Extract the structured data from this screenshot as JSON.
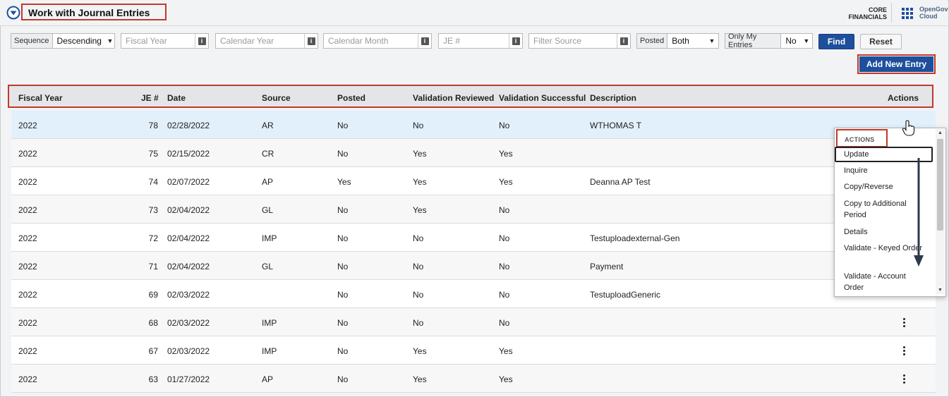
{
  "header": {
    "title": "Work with Journal Entries",
    "product_line1": "CORE",
    "product_line2": "FINANCIALS",
    "brand_line1": "OpenGov",
    "brand_line2": "Cloud",
    "accent": "#1d4f9c",
    "highlight": "#c0392b"
  },
  "filters": {
    "sequence_label": "Sequence",
    "sequence_value": "Descending",
    "fiscal_year_placeholder": "Fiscal Year",
    "calendar_year_placeholder": "Calendar Year",
    "calendar_month_placeholder": "Calendar Month",
    "je_placeholder": "JE #",
    "source_placeholder": "Filter Source",
    "posted_label": "Posted",
    "posted_value": "Both",
    "only_mine_label": "Only My Entries",
    "only_mine_value": "No",
    "find_label": "Find",
    "reset_label": "Reset",
    "add_label": "Add New Entry"
  },
  "table": {
    "columns": [
      "Fiscal Year",
      "JE #",
      "Date",
      "Source",
      "Posted",
      "Validation Reviewed",
      "Validation Successful",
      "Description",
      "Actions"
    ],
    "rows": [
      {
        "fy": "2022",
        "je": "78",
        "date": "02/28/2022",
        "src": "AR",
        "posted": "No",
        "vr": "No",
        "vs": "No",
        "desc": "WTHOMAS T"
      },
      {
        "fy": "2022",
        "je": "75",
        "date": "02/15/2022",
        "src": "CR",
        "posted": "No",
        "vr": "Yes",
        "vs": "Yes",
        "desc": ""
      },
      {
        "fy": "2022",
        "je": "74",
        "date": "02/07/2022",
        "src": "AP",
        "posted": "Yes",
        "vr": "Yes",
        "vs": "Yes",
        "desc": "Deanna AP Test"
      },
      {
        "fy": "2022",
        "je": "73",
        "date": "02/04/2022",
        "src": "GL",
        "posted": "No",
        "vr": "Yes",
        "vs": "No",
        "desc": ""
      },
      {
        "fy": "2022",
        "je": "72",
        "date": "02/04/2022",
        "src": "IMP",
        "posted": "No",
        "vr": "No",
        "vs": "No",
        "desc": "Testuploadexternal-Gen"
      },
      {
        "fy": "2022",
        "je": "71",
        "date": "02/04/2022",
        "src": "GL",
        "posted": "No",
        "vr": "No",
        "vs": "No",
        "desc": "Payment"
      },
      {
        "fy": "2022",
        "je": "69",
        "date": "02/03/2022",
        "src": "",
        "posted": "No",
        "vr": "No",
        "vs": "No",
        "desc": "TestuploadGeneric"
      },
      {
        "fy": "2022",
        "je": "68",
        "date": "02/03/2022",
        "src": "IMP",
        "posted": "No",
        "vr": "No",
        "vs": "No",
        "desc": ""
      },
      {
        "fy": "2022",
        "je": "67",
        "date": "02/03/2022",
        "src": "IMP",
        "posted": "No",
        "vr": "Yes",
        "vs": "Yes",
        "desc": ""
      },
      {
        "fy": "2022",
        "je": "63",
        "date": "01/27/2022",
        "src": "AP",
        "posted": "No",
        "vr": "Yes",
        "vs": "Yes",
        "desc": ""
      }
    ]
  },
  "actions_menu": {
    "heading": "ACTIONS",
    "items": [
      "Update",
      "Inquire",
      "Copy/Reverse",
      "Copy to Additional Period",
      "Details",
      "Validate - Keyed Order",
      "Validate - Account Order"
    ]
  }
}
